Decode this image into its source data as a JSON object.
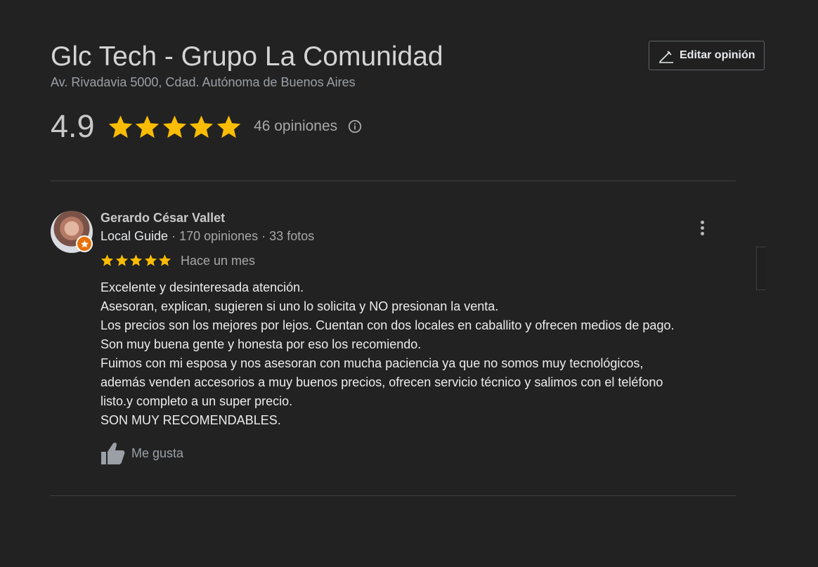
{
  "place": {
    "title": "Glc Tech - Grupo La Comunidad",
    "address": "Av. Rivadavia 5000, Cdad. Autónoma de Buenos Aires",
    "edit_button_label": "Editar opinión",
    "rating": "4.9",
    "stars": 5,
    "review_count_label": "46 opiniones",
    "star_color": "#fbbc04"
  },
  "review": {
    "author": "Gerardo César Vallet",
    "guide_label": "Local Guide",
    "reviews_label": " · 170 opiniones · 33 fotos",
    "stars": 5,
    "date": "Hace un mes",
    "text_lines": [
      "Excelente y desinteresada atención.",
      "Asesoran, explican, sugieren si uno lo solicita y NO presionan la venta.",
      "Los precios son los mejores por lejos. Cuentan con dos locales en caballito y ofrecen medios de pago.",
      "Son muy buena gente y honesta por eso los recomiendo.",
      "Fuimos con mi esposa y nos asesoran con mucha paciencia ya que no somos muy tecnológicos,",
      "además venden accesorios a muy buenos precios, ofrecen servicio técnico y salimos con el teléfono",
      "listo.y completo a un super precio.",
      "SON MUY RECOMENDABLES."
    ],
    "like_label": "Me gusta",
    "badge_color": "#e8710a"
  },
  "icons": {
    "edit": "pencil-icon",
    "info": "info-icon",
    "more": "more-vert-icon",
    "like": "thumb-up-icon",
    "guide": "local-guide-star-icon"
  }
}
